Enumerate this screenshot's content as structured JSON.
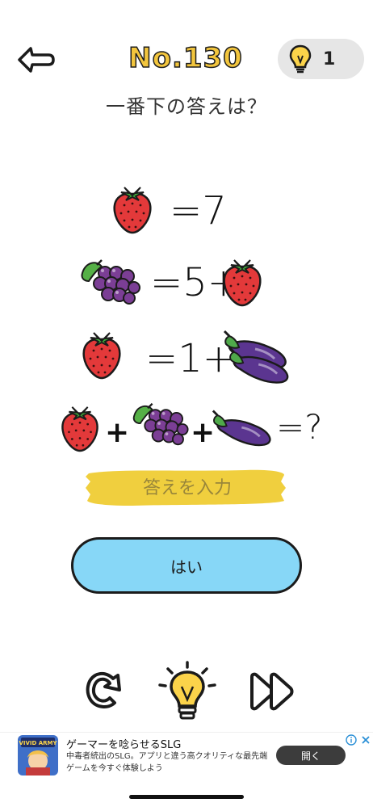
{
  "header": {
    "level_title": "No.130",
    "hint_count": "1"
  },
  "question": "一番下の答えは？",
  "equations": [
    {
      "lhs": [
        "strawberry-icon"
      ],
      "rhs": "=7"
    },
    {
      "lhs": [
        "grapes-icon"
      ],
      "rhs": "=5+",
      "rhs_icons": [
        "strawberry-icon"
      ]
    },
    {
      "lhs": [
        "strawberry-icon"
      ],
      "rhs": "=1+",
      "rhs_icons": [
        "double-eggplant-icon"
      ]
    },
    {
      "lhs": [
        "strawberry-icon",
        "+",
        "grapes-icon",
        "+",
        "eggplant-icon"
      ],
      "rhs": "=?"
    }
  ],
  "eq_text": {
    "row1": "=7",
    "row2": "=5+",
    "row3": "=1+",
    "row4_plus1": "+",
    "row4_plus2": "+",
    "row4_end": "=?"
  },
  "answer": {
    "placeholder": "答えを入力",
    "value": ""
  },
  "submit_label": "はい",
  "controls": [
    "retry-icon",
    "lightbulb-icon",
    "skip-icon"
  ],
  "ad": {
    "title": "ゲーマーを唸らせるSLG",
    "description": "中毒者続出のSLG。アプリと違う高クオリティな最先端ゲームを今すぐ体験しよう",
    "open_label": "開く",
    "thumb_text": "VIVID ARMY"
  },
  "colors": {
    "title_yellow": "#F2C53D",
    "button_blue": "#87D7F7",
    "input_yellow": "#F0CF3E",
    "hint_pill": "#E6E6E6"
  }
}
